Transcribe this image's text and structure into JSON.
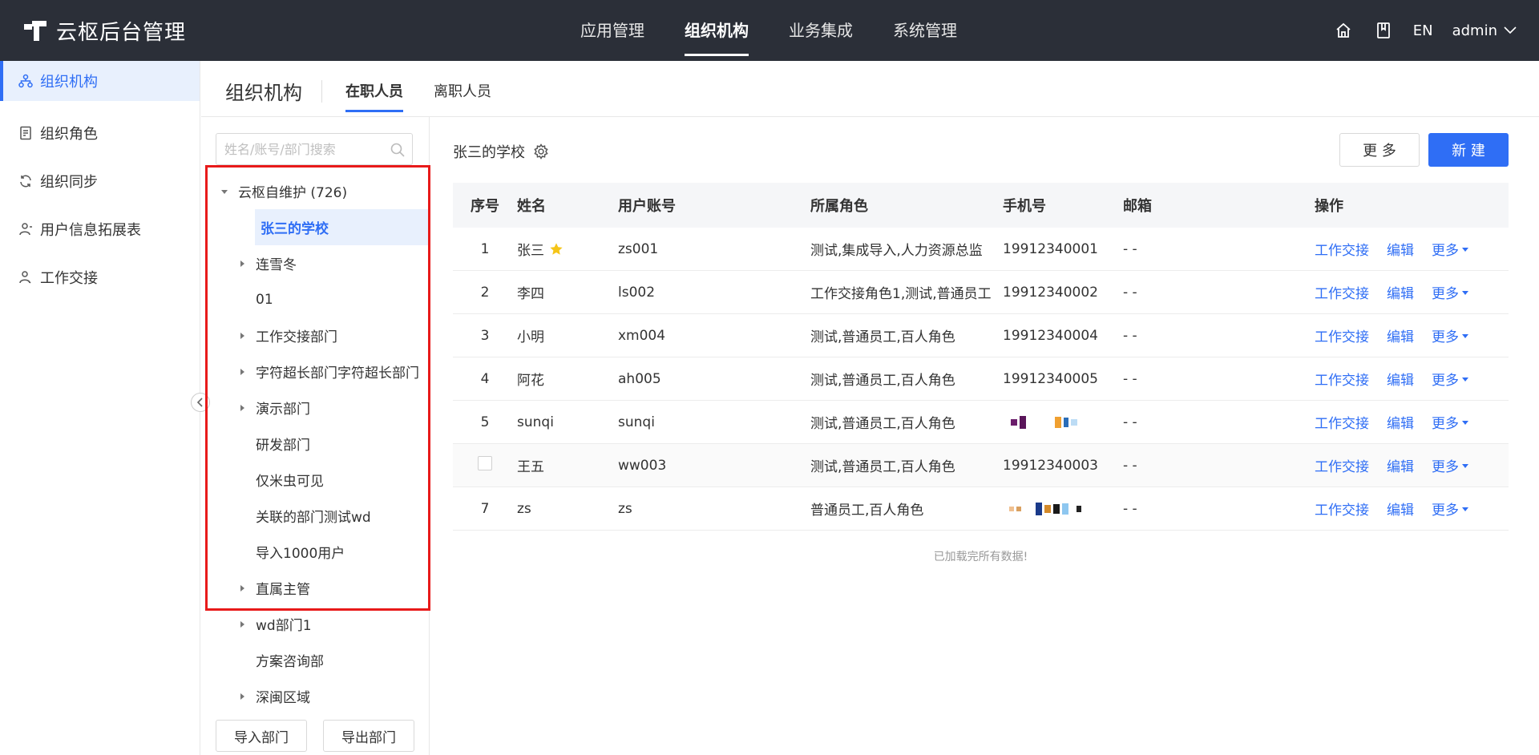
{
  "app": {
    "title": "云枢后台管理"
  },
  "topnav": {
    "items": [
      {
        "label": "应用管理",
        "active": false
      },
      {
        "label": "组织机构",
        "active": true
      },
      {
        "label": "业务集成",
        "active": false
      },
      {
        "label": "系统管理",
        "active": false
      }
    ],
    "lang": "EN",
    "user": "admin"
  },
  "sidebar": {
    "items": [
      {
        "label": "组织机构",
        "icon": "org-icon",
        "active": true
      },
      {
        "label": "组织角色",
        "icon": "role-icon",
        "active": false
      },
      {
        "label": "组织同步",
        "icon": "sync-icon",
        "active": false
      },
      {
        "label": "用户信息拓展表",
        "icon": "user-ext-icon",
        "active": false
      },
      {
        "label": "工作交接",
        "icon": "handover-icon",
        "active": false
      }
    ]
  },
  "header": {
    "title": "组织机构",
    "tabs": [
      {
        "label": "在职人员",
        "active": true
      },
      {
        "label": "离职人员",
        "active": false
      }
    ]
  },
  "tree": {
    "search_placeholder": "姓名/账号/部门搜索",
    "nodes": [
      {
        "label": "云枢自维护 (726)",
        "level": 0,
        "expanded": true,
        "has_children": true
      },
      {
        "label": "张三的学校",
        "level": 1,
        "selected": true,
        "has_children": false
      },
      {
        "label": "连雪冬",
        "level": 1,
        "has_children": true
      },
      {
        "label": "01",
        "level": 1,
        "has_children": false
      },
      {
        "label": "工作交接部门",
        "level": 1,
        "has_children": true
      },
      {
        "label": "字符超长部门字符超长部门",
        "level": 1,
        "has_children": true
      },
      {
        "label": "演示部门",
        "level": 1,
        "has_children": true
      },
      {
        "label": "研发部门",
        "level": 1,
        "has_children": false
      },
      {
        "label": "仅米虫可见",
        "level": 1,
        "has_children": false
      },
      {
        "label": "关联的部门测试wd",
        "level": 1,
        "has_children": false
      },
      {
        "label": "导入1000用户",
        "level": 1,
        "has_children": false
      },
      {
        "label": "直属主管",
        "level": 1,
        "has_children": true
      },
      {
        "label": "wd部门1",
        "level": 1,
        "has_children": true
      },
      {
        "label": "方案咨询部",
        "level": 1,
        "has_children": false
      },
      {
        "label": "深闽区域",
        "level": 1,
        "has_children": true
      }
    ],
    "import_label": "导入部门",
    "export_label": "导出部门"
  },
  "main": {
    "dept_title": "张三的学校",
    "more_label": "更 多",
    "new_label": "新 建",
    "columns": [
      "序号",
      "姓名",
      "用户账号",
      "所属角色",
      "手机号",
      "邮箱",
      "操作"
    ],
    "rows": [
      {
        "idx": "1",
        "name": "张三",
        "starred": true,
        "account": "zs001",
        "role": "测试,集成导入,人力资源总监",
        "phone": "19912340001",
        "email": "- -"
      },
      {
        "idx": "2",
        "name": "李四",
        "account": "ls002",
        "role": "工作交接角色1,测试,普通员工",
        "phone": "19912340002",
        "email": "- -"
      },
      {
        "idx": "3",
        "name": "小明",
        "account": "xm004",
        "role": "测试,普通员工,百人角色",
        "phone": "19912340004",
        "email": "- -"
      },
      {
        "idx": "4",
        "name": "阿花",
        "account": "ah005",
        "role": "测试,普通员工,百人角色",
        "phone": "19912340005",
        "email": "- -"
      },
      {
        "idx": "5",
        "name": "sunqi",
        "account": "sunqi",
        "role": "测试,普通员工,百人角色",
        "phone": "",
        "phone_redacted": true,
        "email": "- -"
      },
      {
        "idx": "",
        "checkbox": true,
        "name": "王五",
        "account": "ww003",
        "role": "测试,普通员工,百人角色",
        "phone": "19912340003",
        "email": "- -"
      },
      {
        "idx": "7",
        "name": "zs",
        "account": "zs",
        "role": "普通员工,百人角色",
        "phone": "",
        "phone_redacted": true,
        "email": "- -"
      }
    ],
    "ops": {
      "handover": "工作交接",
      "edit": "编辑",
      "more": "更多"
    },
    "footer": "已加载完所有数据!"
  },
  "colors": {
    "accent": "#2f6ef5",
    "topbar": "#2b2f38",
    "highlight": "#e81a1a",
    "star": "#f5c518"
  }
}
